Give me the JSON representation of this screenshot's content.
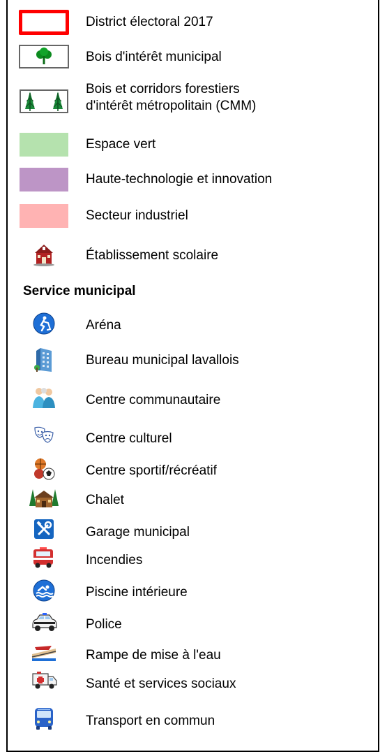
{
  "legend": {
    "items": [
      {
        "label": "District électoral 2017",
        "symbol": "district-outline",
        "color": "#ff0000"
      },
      {
        "label": "Bois d'intérêt municipal",
        "symbol": "single-tree",
        "color": "#008000"
      },
      {
        "label_line1": "Bois et corridors forestiers",
        "label_line2": "d'intérêt métropolitain (CMM)",
        "symbol": "two-pine-trees",
        "color": "#1a8a3a"
      },
      {
        "label": "Espace vert",
        "symbol": "fill",
        "color": "#b5e2ae"
      },
      {
        "label": "Haute-technologie et innovation",
        "symbol": "fill",
        "color": "#bd95c6"
      },
      {
        "label": "Secteur industriel",
        "symbol": "fill",
        "color": "#ffb3b3"
      },
      {
        "label": "Établissement scolaire",
        "symbol": "school-icon"
      }
    ],
    "service_heading": "Service municipal",
    "services": [
      {
        "label": "Aréna",
        "icon": "arena-icon"
      },
      {
        "label": "Bureau municipal lavallois",
        "icon": "office-building-icon"
      },
      {
        "label": "Centre communautaire",
        "icon": "community-center-icon"
      },
      {
        "label": "Centre culturel",
        "icon": "theatre-masks-icon"
      },
      {
        "label": "Centre sportif/récréatif",
        "icon": "sports-balls-icon"
      },
      {
        "label": "Chalet",
        "icon": "chalet-icon"
      },
      {
        "label": "Garage municipal",
        "icon": "tools-icon"
      },
      {
        "label": "Incendies",
        "icon": "fire-truck-icon"
      },
      {
        "label": "Piscine intérieure",
        "icon": "swimmer-icon"
      },
      {
        "label": "Police",
        "icon": "police-car-icon"
      },
      {
        "label": "Rampe de mise à l'eau",
        "icon": "boat-ramp-icon"
      },
      {
        "label": "Santé et services sociaux",
        "icon": "ambulance-icon"
      },
      {
        "label": "Transport en commun",
        "icon": "bus-icon"
      }
    ]
  }
}
